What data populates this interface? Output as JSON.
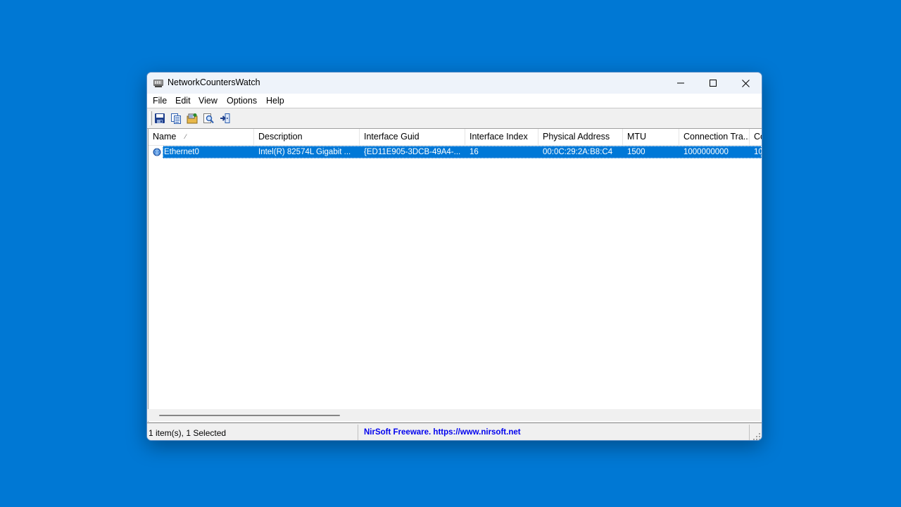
{
  "window": {
    "title": "NetworkCountersWatch"
  },
  "menu": [
    "File",
    "Edit",
    "View",
    "Options",
    "Help"
  ],
  "toolbar": {
    "buttons": [
      "save-icon",
      "copy-icon",
      "properties-icon",
      "find-icon",
      "exit-icon"
    ]
  },
  "columns": [
    "Name",
    "Description",
    "Interface Guid",
    "Interface Index",
    "Physical Address",
    "MTU",
    "Connection Tra...",
    "Co"
  ],
  "sort_indicator": "⁄",
  "rows": [
    {
      "name": "Ethernet0",
      "description": "Intel(R) 82574L Gigabit ...",
      "guid": "{ED11E905-3DCB-49A4-...",
      "index": "16",
      "mac": "00:0C:29:2A:B8:C4",
      "mtu": "1500",
      "speed": "1000000000",
      "extra": "10",
      "selected": true
    }
  ],
  "status": {
    "count": "1 item(s), 1 Selected",
    "link": "NirSoft Freeware. https://www.nirsoft.net"
  },
  "colors": {
    "desktop": "#0078d4",
    "selection": "#0078d7",
    "link": "#0000ee"
  }
}
